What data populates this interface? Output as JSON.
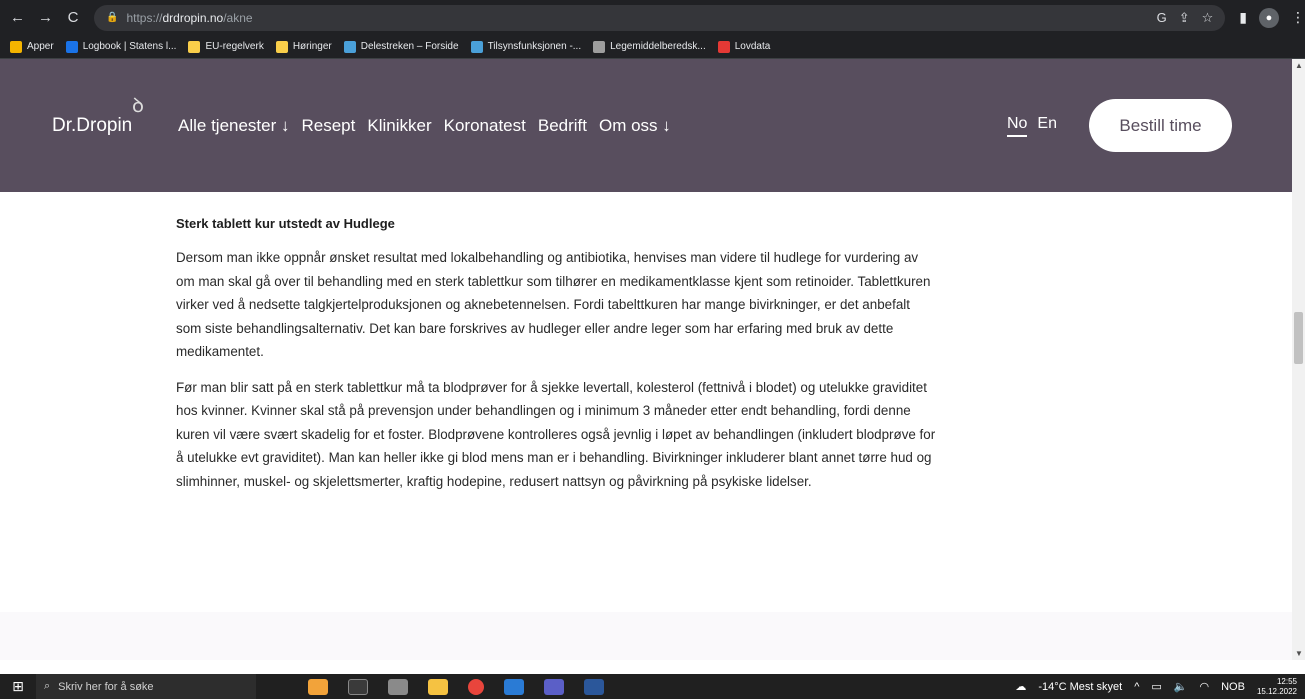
{
  "browser": {
    "url_prefix": "https://",
    "url_host": "drdropin.no",
    "url_path": "/akne",
    "back_icon": "arrow-left-icon",
    "forward_icon": "arrow-right-icon",
    "reload_icon": "reload-icon",
    "bookmarks": [
      {
        "label": "Apper",
        "color": "#f4b400"
      },
      {
        "label": "Logbook | Statens l...",
        "color": "#1a73e8"
      },
      {
        "label": "EU-regelverk",
        "color": "#f9ce4a"
      },
      {
        "label": "Høringer",
        "color": "#f9ce4a"
      },
      {
        "label": "Delestreken – Forside",
        "color": "#4aa0d9"
      },
      {
        "label": "Tilsynsfunksjonen -...",
        "color": "#4aa0d9"
      },
      {
        "label": "Legemiddelberedsk...",
        "color": "#9e9e9e"
      },
      {
        "label": "Lovdata",
        "color": "#e53935"
      }
    ]
  },
  "site": {
    "logo": "Dr.Dropin",
    "menu": [
      "Alle tjenester ↓",
      "Resept",
      "Klinikker",
      "Koronatest",
      "Bedrift",
      "Om oss ↓"
    ],
    "lang_no": "No",
    "lang_en": "En",
    "book_button": "Bestill time",
    "header_bg": "#584e5e"
  },
  "article": {
    "heading": "Sterk tablett kur utstedt av Hudlege",
    "paragraph1": "Dersom man ikke oppnår ønsket resultat med lokalbehandling og antibiotika, henvises man videre til hudlege for vurdering av om man skal gå over til behandling med en sterk tablettkur som tilhører en medikamentklasse kjent som retinoider. Tablettkuren virker ved å nedsette talgkjertelproduksjonen og aknebetennelsen. Fordi tabelttkuren har mange bivirkninger, er det anbefalt som siste behandlingsalternativ. Det kan bare forskrives av hudleger eller andre leger som har erfaring med bruk av dette medikamentet.",
    "paragraph2": "Før man blir satt på en sterk tablettkur må ta blodprøver for å sjekke levertall, kolesterol (fettnivå i blodet) og utelukke graviditet hos kvinner. Kvinner skal stå på prevensjon under behandlingen og i minimum 3 måneder etter endt behandling, fordi denne kuren vil være svært skadelig for et foster. Blodprøvene kontrolleres også jevnlig i løpet av behandlingen (inkludert blodprøve for å utelukke evt graviditet). Man kan heller ikke gi blod mens man er i behandling. Bivirkninger inkluderer blant annet tørre hud og slimhinner, muskel- og skjelettsmerter, kraftig hodepine, redusert nattsyn og påvirkning på psykiske lidelser."
  },
  "taskbar": {
    "search_placeholder": "Skriv her for å søke",
    "weather": "-14°C  Mest skyet",
    "lang": "NOB",
    "time": "12:55",
    "date": "15.12.2022"
  }
}
